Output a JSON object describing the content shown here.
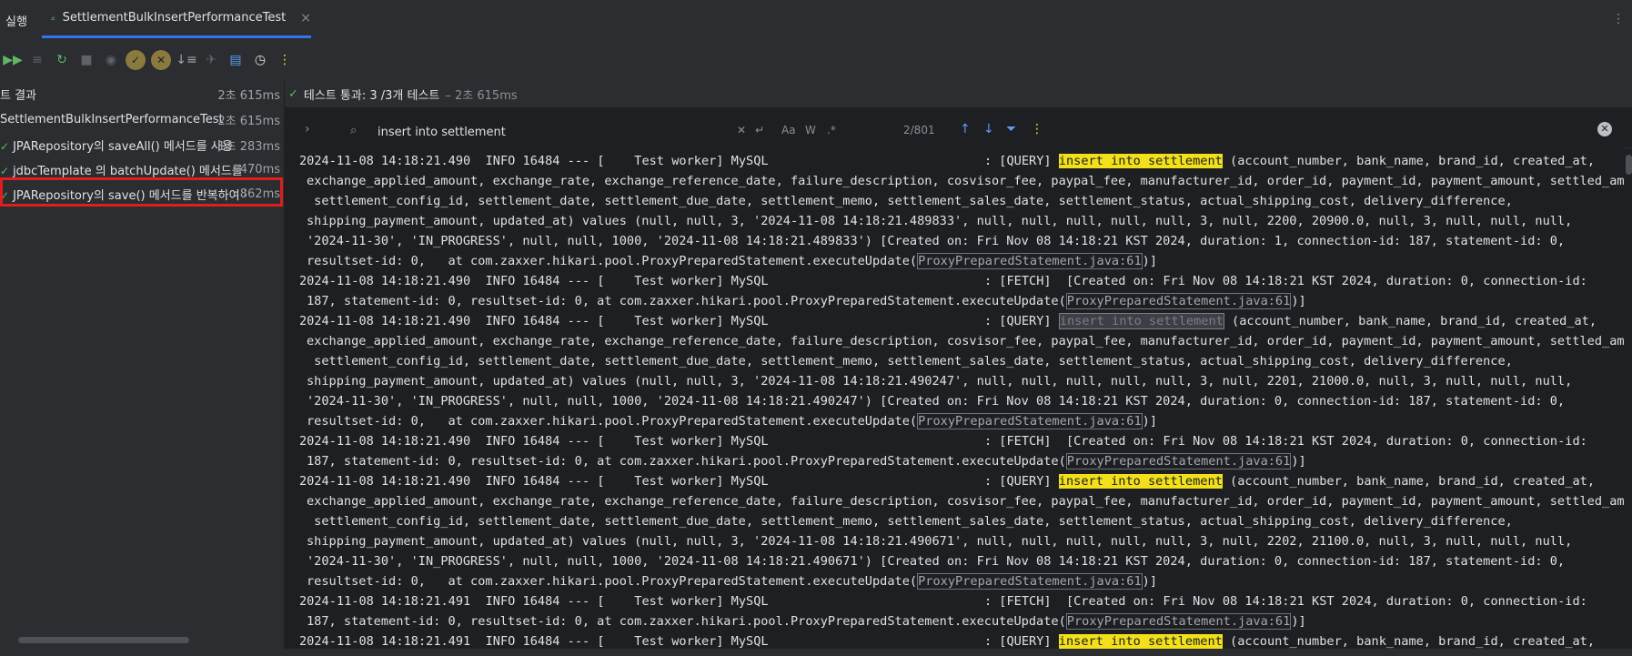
{
  "tabbar": {
    "run_label": "실행",
    "active_tab": "SettlementBulkInsertPerformanceTest",
    "close": "×",
    "more": "⋮"
  },
  "tree": {
    "root": {
      "label": "트 결과",
      "time": "2초 615ms"
    },
    "suite": {
      "label": "SettlementBulkInsertPerformanceTest",
      "time": "2초 615ms"
    },
    "tests": [
      {
        "label": "JPARepository의 saveAll() 메서드를 사용",
        "time": "1초 283ms"
      },
      {
        "label": "jdbcTemplate 의 batchUpdate() 메서드를 사",
        "time": "470ms"
      },
      {
        "label": "JPARepository의 save() 메서드를 반복하여 정",
        "time": "862ms"
      }
    ]
  },
  "status": {
    "text": "테스트 통과: 3 /3개 테스트",
    "duration": "– 2초 615ms"
  },
  "search": {
    "query": "insert into settlement",
    "count": "2/801",
    "case_label": "Aa",
    "word_label": "W",
    "regex_label": ".*"
  },
  "console": {
    "lines": [
      {
        "segs": [
          {
            "t": "2024-11-08 14:18:21.490  INFO 16484 --- [    Test worker] MySQL                             : [QUERY] "
          },
          {
            "t": "insert into settlement",
            "hl": "yellow"
          },
          {
            "t": " (account_number, bank_name, brand_id, created_at,"
          }
        ]
      },
      {
        "ind": true,
        "segs": [
          {
            "t": "exchange_applied_amount, exchange_rate, exchange_reference_date, failure_description, cosvisor_fee, paypal_fee, manufacturer_id, order_id, payment_id, payment_amount, settled_amount,"
          }
        ]
      },
      {
        "ind": true,
        "segs": [
          {
            "t": " settlement_config_id, settlement_date, settlement_due_date, settlement_memo, settlement_sales_date, settlement_status, actual_shipping_cost, delivery_difference,"
          }
        ]
      },
      {
        "ind": true,
        "segs": [
          {
            "t": "shipping_payment_amount, updated_at) values (null, null, 3, '2024-11-08 14:18:21.489833', null, null, null, null, null, 3, null, 2200, 20900.0, null, 3, null, null, null,"
          }
        ]
      },
      {
        "ind": true,
        "segs": [
          {
            "t": "'2024-11-30', 'IN_PROGRESS', null, null, 1000, '2024-11-08 14:18:21.489833') [Created on: Fri Nov 08 14:18:21 KST 2024, duration: 1, connection-id: 187, statement-id: 0,"
          }
        ]
      },
      {
        "ind": true,
        "segs": [
          {
            "t": "resultset-id: 0,   at com.zaxxer.hikari.pool.ProxyPreparedStatement.executeUpdate("
          },
          {
            "t": "ProxyPreparedStatement.java:61",
            "hl": "link"
          },
          {
            "t": ")]"
          }
        ]
      },
      {
        "segs": [
          {
            "t": "2024-11-08 14:18:21.490  INFO 16484 --- [    Test worker] MySQL                             : [FETCH]  [Created on: Fri Nov 08 14:18:21 KST 2024, duration: 0, connection-id:"
          }
        ]
      },
      {
        "ind": true,
        "segs": [
          {
            "t": "187, statement-id: 0, resultset-id: 0, at com.zaxxer.hikari.pool.ProxyPreparedStatement.executeUpdate("
          },
          {
            "t": "ProxyPreparedStatement.java:61",
            "hl": "link"
          },
          {
            "t": ")]"
          }
        ]
      },
      {
        "segs": [
          {
            "t": "2024-11-08 14:18:21.490  INFO 16484 --- [    Test worker] MySQL                             : [QUERY] "
          },
          {
            "t": "insert into settlement",
            "hl": "box"
          },
          {
            "t": " (account_number, bank_name, brand_id, created_at,"
          }
        ]
      },
      {
        "ind": true,
        "segs": [
          {
            "t": "exchange_applied_amount, exchange_rate, exchange_reference_date, failure_description, cosvisor_fee, paypal_fee, manufacturer_id, order_id, payment_id, payment_amount, settled_amount,"
          }
        ]
      },
      {
        "ind": true,
        "segs": [
          {
            "t": " settlement_config_id, settlement_date, settlement_due_date, settlement_memo, settlement_sales_date, settlement_status, actual_shipping_cost, delivery_difference,"
          }
        ]
      },
      {
        "ind": true,
        "segs": [
          {
            "t": "shipping_payment_amount, updated_at) values (null, null, 3, '2024-11-08 14:18:21.490247', null, null, null, null, null, 3, null, 2201, 21000.0, null, 3, null, null, null,"
          }
        ]
      },
      {
        "ind": true,
        "segs": [
          {
            "t": "'2024-11-30', 'IN_PROGRESS', null, null, 1000, '2024-11-08 14:18:21.490247') [Created on: Fri Nov 08 14:18:21 KST 2024, duration: 0, connection-id: 187, statement-id: 0,"
          }
        ]
      },
      {
        "ind": true,
        "segs": [
          {
            "t": "resultset-id: 0,   at com.zaxxer.hikari.pool.ProxyPreparedStatement.executeUpdate("
          },
          {
            "t": "ProxyPreparedStatement.java:61",
            "hl": "link"
          },
          {
            "t": ")]"
          }
        ]
      },
      {
        "segs": [
          {
            "t": "2024-11-08 14:18:21.490  INFO 16484 --- [    Test worker] MySQL                             : [FETCH]  [Created on: Fri Nov 08 14:18:21 KST 2024, duration: 0, connection-id:"
          }
        ]
      },
      {
        "ind": true,
        "segs": [
          {
            "t": "187, statement-id: 0, resultset-id: 0, at com.zaxxer.hikari.pool.ProxyPreparedStatement.executeUpdate("
          },
          {
            "t": "ProxyPreparedStatement.java:61",
            "hl": "link"
          },
          {
            "t": ")]"
          }
        ]
      },
      {
        "segs": [
          {
            "t": "2024-11-08 14:18:21.490  INFO 16484 --- [    Test worker] MySQL                             : [QUERY] "
          },
          {
            "t": "insert into settlement",
            "hl": "yellow"
          },
          {
            "t": " (account_number, bank_name, brand_id, created_at,"
          }
        ]
      },
      {
        "ind": true,
        "segs": [
          {
            "t": "exchange_applied_amount, exchange_rate, exchange_reference_date, failure_description, cosvisor_fee, paypal_fee, manufacturer_id, order_id, payment_id, payment_amount, settled_amount,"
          }
        ]
      },
      {
        "ind": true,
        "segs": [
          {
            "t": " settlement_config_id, settlement_date, settlement_due_date, settlement_memo, settlement_sales_date, settlement_status, actual_shipping_cost, delivery_difference,"
          }
        ]
      },
      {
        "ind": true,
        "segs": [
          {
            "t": "shipping_payment_amount, updated_at) values (null, null, 3, '2024-11-08 14:18:21.490671', null, null, null, null, null, 3, null, 2202, 21100.0, null, 3, null, null, null,"
          }
        ]
      },
      {
        "ind": true,
        "segs": [
          {
            "t": "'2024-11-30', 'IN_PROGRESS', null, null, 1000, '2024-11-08 14:18:21.490671') [Created on: Fri Nov 08 14:18:21 KST 2024, duration: 0, connection-id: 187, statement-id: 0,"
          }
        ]
      },
      {
        "ind": true,
        "segs": [
          {
            "t": "resultset-id: 0,   at com.zaxxer.hikari.pool.ProxyPreparedStatement.executeUpdate("
          },
          {
            "t": "ProxyPreparedStatement.java:61",
            "hl": "link"
          },
          {
            "t": ")]"
          }
        ]
      },
      {
        "segs": [
          {
            "t": "2024-11-08 14:18:21.491  INFO 16484 --- [    Test worker] MySQL                             : [FETCH]  [Created on: Fri Nov 08 14:18:21 KST 2024, duration: 0, connection-id:"
          }
        ]
      },
      {
        "ind": true,
        "segs": [
          {
            "t": "187, statement-id: 0, resultset-id: 0, at com.zaxxer.hikari.pool.ProxyPreparedStatement.executeUpdate("
          },
          {
            "t": "ProxyPreparedStatement.java:61",
            "hl": "link"
          },
          {
            "t": ")]"
          }
        ]
      },
      {
        "segs": [
          {
            "t": "2024-11-08 14:18:21.491  INFO 16484 --- [    Test worker] MySQL                             : [QUERY] "
          },
          {
            "t": "insert into settlement",
            "hl": "yellow"
          },
          {
            "t": " (account_number, bank_name, brand_id, created_at,"
          }
        ]
      }
    ]
  },
  "colors": {
    "accent": "#3574f0",
    "pass": "#5fb865",
    "highlight": "#f2e01a",
    "selection_border": "#e11d1d"
  }
}
